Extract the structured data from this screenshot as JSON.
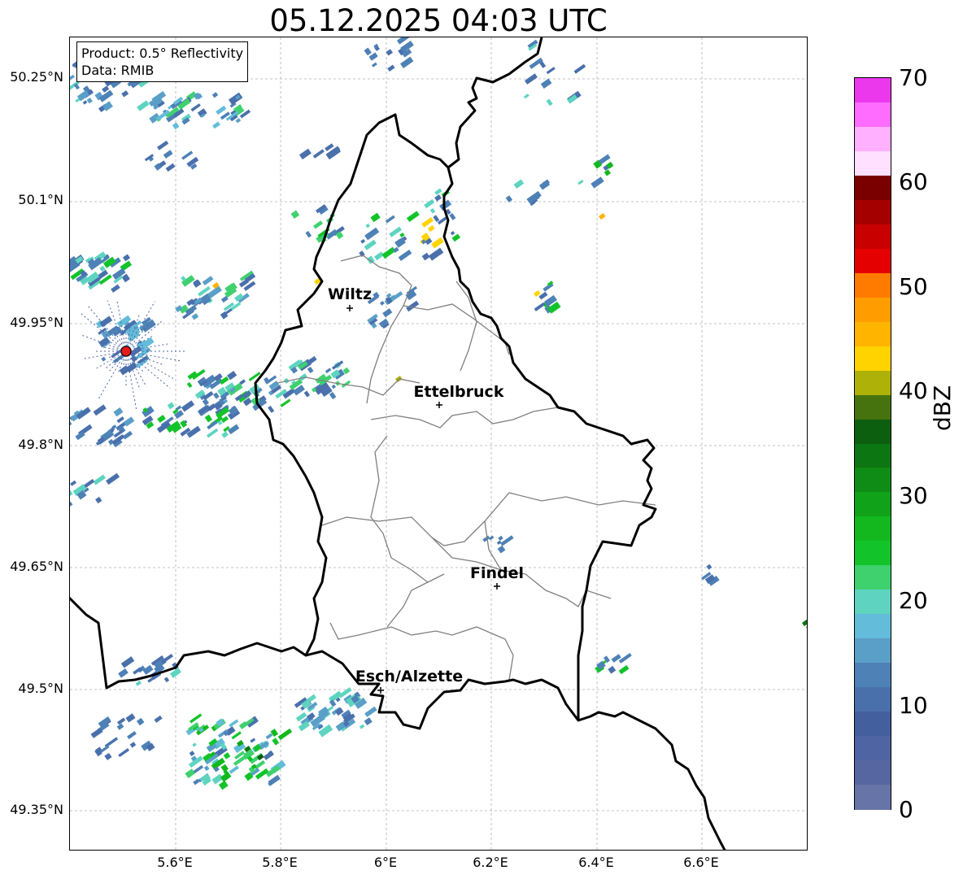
{
  "title": "05.12.2025 04:03 UTC",
  "info_box": {
    "product": "Product: 0.5° Reflectivity",
    "data": "Data: RMIB"
  },
  "axes": {
    "lat_ticks": [
      "50.25°N",
      "50.1°N",
      "49.95°N",
      "49.8°N",
      "49.65°N",
      "49.5°N",
      "49.35°N"
    ],
    "lon_ticks": [
      "5.6°E",
      "5.8°E",
      "6°E",
      "6.2°E",
      "6.4°E",
      "6.6°E"
    ],
    "grid": true
  },
  "cities": [
    {
      "name": "Wiltz"
    },
    {
      "name": "Ettelbruck"
    },
    {
      "name": "Findel"
    },
    {
      "name": "Esch/Alzette"
    }
  ],
  "colorbar": {
    "label": "dBZ",
    "ticks": [
      "0",
      "10",
      "20",
      "30",
      "40",
      "50",
      "60",
      "70"
    ],
    "colors": [
      "#6674a8",
      "#5666a0",
      "#4f64a2",
      "#445f9e",
      "#4a70ac",
      "#4e81b6",
      "#5a9fc8",
      "#63bcd9",
      "#5ed4c0",
      "#3fd16e",
      "#12c42a",
      "#12b81e",
      "#10a31a",
      "#0f8c15",
      "#0c7612",
      "#0b5f0f",
      "#47730f",
      "#aeb108",
      "#ffd300",
      "#ffb400",
      "#ff9d00",
      "#ff7b00",
      "#e50000",
      "#c80000",
      "#a50000",
      "#7a0000",
      "#ffe0ff",
      "#ffb0ff",
      "#ff6cff",
      "#ec38ec"
    ]
  },
  "radar_site_color": "#e51a1a"
}
